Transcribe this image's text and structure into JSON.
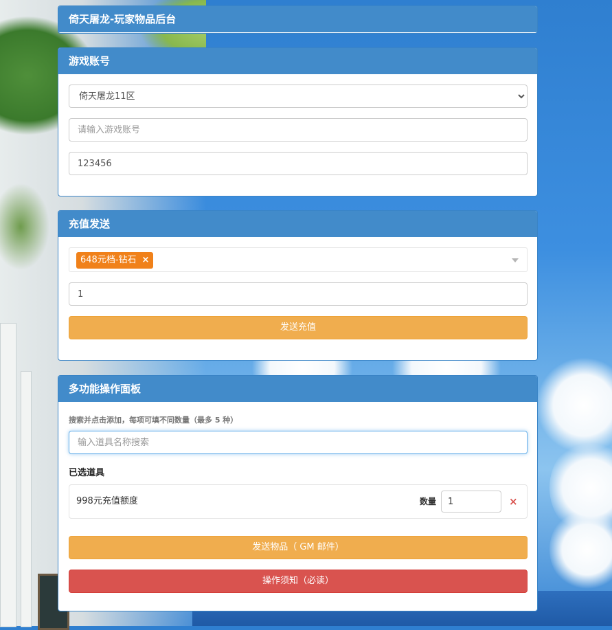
{
  "header": {
    "title": "倚天屠龙-玩家物品后台"
  },
  "account_panel": {
    "title": "游戏账号",
    "server_select": {
      "value": "倚天屠龙11区",
      "options": [
        "倚天屠龙11区"
      ]
    },
    "account_input": {
      "value": "",
      "placeholder": "请输入游戏账号"
    },
    "password_input": {
      "value": "123456"
    }
  },
  "recharge_panel": {
    "title": "充值发送",
    "selected_tag": {
      "label": "648元档-钻石",
      "remove": "×"
    },
    "quantity_input": {
      "value": "1"
    },
    "send_button": "发送充值"
  },
  "multi_panel": {
    "title": "多功能操作面板",
    "hint": "搜索并点击添加，每项可填不同数量（最多 5 种）",
    "search_input": {
      "value": "",
      "placeholder": "输入道具名称搜索"
    },
    "selected_title": "已选道具",
    "items": [
      {
        "name": "998元充值额度",
        "qty_label": "数量",
        "qty": "1",
        "remove": "×"
      }
    ],
    "send_button": "发送物品（ GM 邮件）",
    "notice_button": "操作须知（必读）"
  },
  "colors": {
    "panel_header": "#428bca",
    "warning_button": "#f0ad4e",
    "danger_button": "#d9534f",
    "tag": "#f0811a"
  }
}
